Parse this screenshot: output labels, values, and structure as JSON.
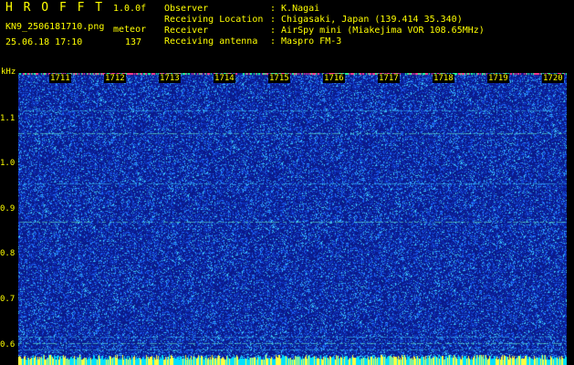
{
  "header": {
    "app_name": "H R O F F T",
    "version": "1.0.0f",
    "file_name": "KN9_2506181710.png",
    "meteor_label": "meteor",
    "date_time": "25.06.18 17:10",
    "meteor_count": "137"
  },
  "info": [
    {
      "label": "Observer",
      "value": ": K.Nagai"
    },
    {
      "label": "Receiving Location",
      "value": ": Chigasaki, Japan (139.414 35.340)"
    },
    {
      "label": "Receiver",
      "value": ": AirSpy mini (Miakejima VOR 108.65MHz)"
    },
    {
      "label": "Receiving antenna",
      "value": ": Maspro FM-3"
    }
  ],
  "spectrogram": {
    "y_unit": "kHz",
    "y_ticks": [
      "1.1",
      "1.0",
      "0.9",
      "0.8",
      "0.7",
      "0.6"
    ],
    "x_ticks": [
      "1711",
      "1712",
      "1713",
      "1714",
      "1715",
      "1716",
      "1717",
      "1718",
      "1719",
      "1720"
    ],
    "colors": {
      "background": "#0a1a8a",
      "noise_light": "#3fd0ff",
      "noise_mid": "#1e6cff",
      "carrier": "#6affd0",
      "axis_text": "#ffff00",
      "baseline": "#00e0ff"
    }
  }
}
